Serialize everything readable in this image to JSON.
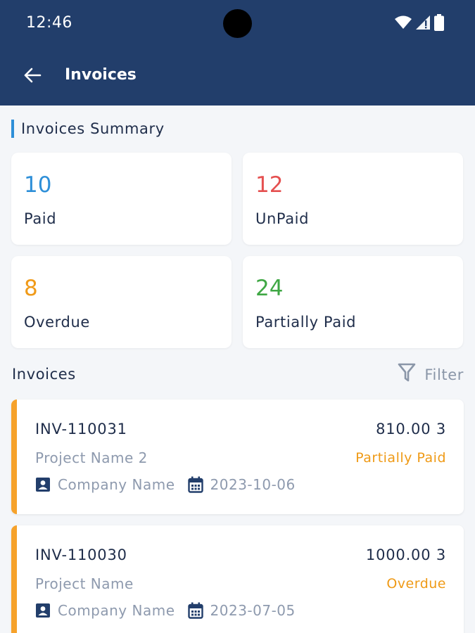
{
  "status_bar": {
    "time": "12:46"
  },
  "app_bar": {
    "title": "Invoices",
    "back_icon": "arrow-left-icon"
  },
  "summary": {
    "title": "Invoices Summary",
    "cards": [
      {
        "count": "10",
        "label": "Paid",
        "color": "#2e8fd8"
      },
      {
        "count": "12",
        "label": "UnPaid",
        "color": "#e55050"
      },
      {
        "count": "8",
        "label": "Overdue",
        "color": "#f09a18"
      },
      {
        "count": "24",
        "label": "Partially Paid",
        "color": "#3fa744"
      }
    ]
  },
  "invoices": {
    "title": "Invoices",
    "filter_label": "Filter",
    "items": [
      {
        "id": "INV-110031",
        "amount": "810.00 3",
        "project": "Project Name 2",
        "status": "Partially Paid",
        "company": "Company Name",
        "date": "2023-10-06"
      },
      {
        "id": "INV-110030",
        "amount": "1000.00 3",
        "project": "Project Name",
        "status": "Overdue",
        "company": "Company Name",
        "date": "2023-07-05"
      }
    ]
  },
  "colors": {
    "app_bar": "#223e6b",
    "accent_bar": "#f6a22b",
    "status_text": "#ef9a16"
  }
}
